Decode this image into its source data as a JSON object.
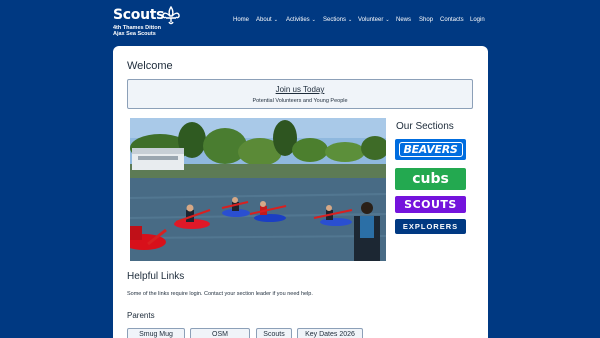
{
  "header": {
    "logo_word": "Scouts",
    "logo_line1": "4th Thames Ditton",
    "logo_line2": "Ajax Sea Scouts",
    "logo_icon": "fleur-de-lis-icon"
  },
  "nav": [
    {
      "label": "Home",
      "has_dropdown": false
    },
    {
      "label": "About",
      "has_dropdown": true
    },
    {
      "label": "Activities",
      "has_dropdown": true
    },
    {
      "label": "Sections",
      "has_dropdown": true
    },
    {
      "label": "Volunteer",
      "has_dropdown": true
    },
    {
      "label": "News",
      "has_dropdown": false
    },
    {
      "label": "Shop",
      "has_dropdown": false
    },
    {
      "label": "Contacts",
      "has_dropdown": false
    },
    {
      "label": "Login",
      "has_dropdown": false
    }
  ],
  "main": {
    "welcome_heading": "Welcome",
    "join": {
      "title": "Join us Today",
      "subtitle": "Potential Volunteers and Young People"
    },
    "sections": {
      "title": "Our Sections",
      "items": [
        {
          "label": "BEAVERS",
          "color": "#006ddf"
        },
        {
          "label": "cubs",
          "color": "#23a950"
        },
        {
          "label": "SCOUTS",
          "color": "#7413dc"
        },
        {
          "label": "EXPLORERS",
          "color": "#003982"
        }
      ]
    },
    "helpful": {
      "heading": "Helpful Links",
      "note": "Some of the links require login. Contact your section leader if you need help."
    },
    "parents": {
      "heading": "Parents",
      "links": [
        "Smug Mug",
        "OSM",
        "Scouts",
        "Key Dates 2026"
      ]
    }
  },
  "colors": {
    "background": "#003982",
    "card": "#ffffff",
    "text": "#1d2b3a"
  }
}
